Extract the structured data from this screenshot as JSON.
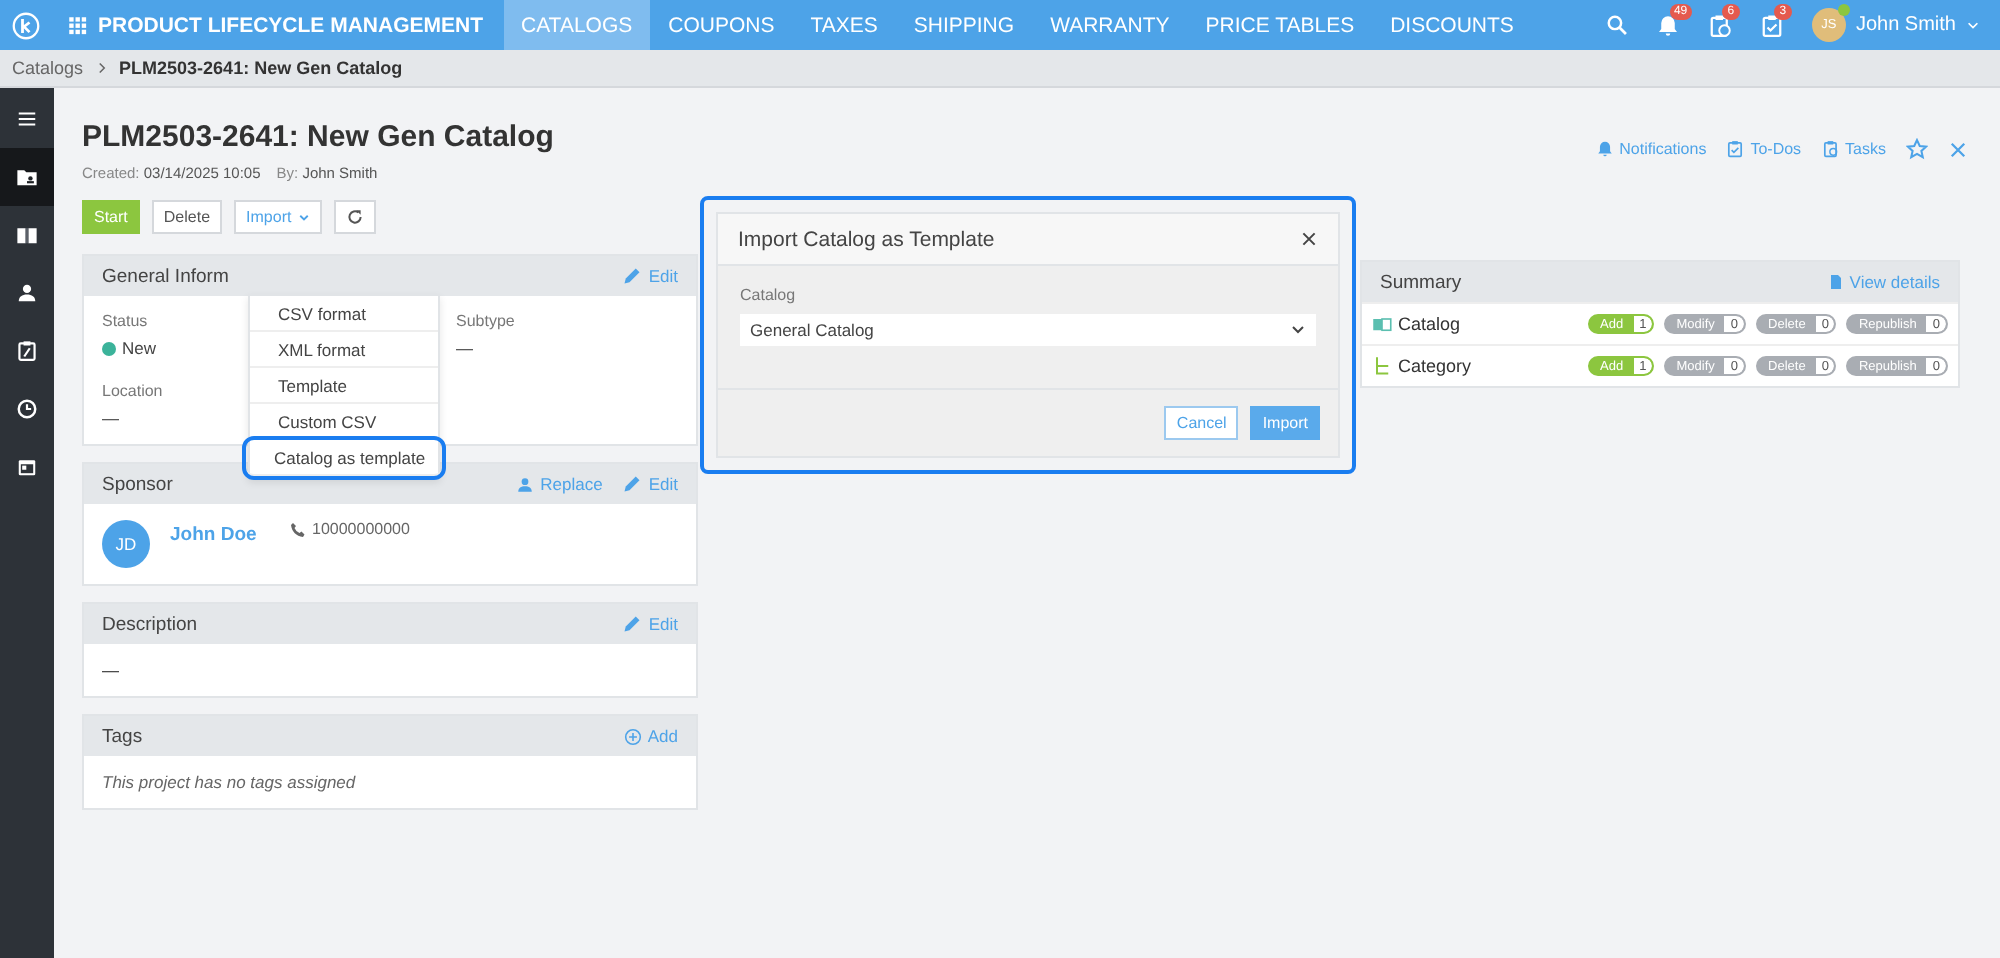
{
  "topbar": {
    "app_title": "PRODUCT LIFECYCLE MANAGEMENT",
    "tabs": [
      {
        "label": "CATALOGS",
        "selected": true
      },
      {
        "label": "COUPONS",
        "selected": false
      },
      {
        "label": "TAXES",
        "selected": false
      },
      {
        "label": "SHIPPING",
        "selected": false
      },
      {
        "label": "WARRANTY",
        "selected": false
      },
      {
        "label": "PRICE TABLES",
        "selected": false
      },
      {
        "label": "DISCOUNTS",
        "selected": false
      }
    ],
    "badges": [
      {
        "kind": "bell",
        "count": "49"
      },
      {
        "kind": "clipboard-clock",
        "count": "6"
      },
      {
        "kind": "clipboard-check",
        "count": "3"
      }
    ],
    "user": {
      "initials": "JS",
      "name": "John Smith"
    }
  },
  "breadcrumb": [
    "Catalogs",
    "PLM2503-2641: New Gen Catalog"
  ],
  "sidebar": [
    {
      "kind": "folder",
      "selected": true
    },
    {
      "kind": "book",
      "selected": false
    },
    {
      "kind": "person",
      "selected": false
    },
    {
      "kind": "clipboard",
      "selected": false
    },
    {
      "kind": "clock",
      "selected": false
    },
    {
      "kind": "calendar",
      "selected": false
    }
  ],
  "header": {
    "title": "PLM2503-2641: New Gen Catalog",
    "created_label": "Created:",
    "created": "03/14/2025 10:05",
    "by_label": "By:",
    "by": "John Smith",
    "links": [
      {
        "kind": "bell",
        "label": "Notifications"
      },
      {
        "kind": "check",
        "label": "To-Dos"
      },
      {
        "kind": "clock",
        "label": "Tasks"
      }
    ]
  },
  "actions": {
    "start": "Start",
    "delete": "Delete",
    "import": "Import"
  },
  "import_menu": [
    {
      "label": "CSV format",
      "highlighted": false
    },
    {
      "label": "XML format",
      "highlighted": false
    },
    {
      "label": "Template",
      "highlighted": false
    },
    {
      "label": "Custom CSV",
      "highlighted": false
    },
    {
      "label": "Catalog as template",
      "highlighted": true
    }
  ],
  "general": {
    "title": "General Inform",
    "edit": "Edit",
    "status_label": "Status",
    "status": "New",
    "subtype_label": "Subtype",
    "subtype": "—",
    "location_label": "Location",
    "location": "—"
  },
  "sponsor": {
    "title": "Sponsor",
    "replace": "Replace",
    "edit": "Edit",
    "initials": "JD",
    "name": "John Doe",
    "phone": "10000000000"
  },
  "description": {
    "title": "Description",
    "edit": "Edit",
    "text": "—"
  },
  "tags": {
    "title": "Tags",
    "add": "Add",
    "empty": "This project has no tags assigned"
  },
  "modal": {
    "title": "Import Catalog as Template",
    "highlighted": true,
    "field_label": "Catalog",
    "value": "General Catalog",
    "cancel": "Cancel",
    "confirm": "Import"
  },
  "summary": {
    "title": "Summary",
    "link": "View details",
    "rows": [
      {
        "kind": "catalog",
        "name": "Catalog",
        "tags": [
          {
            "label": "Add",
            "count": "1",
            "color": "#8cc63f"
          },
          {
            "label": "Modify",
            "count": "0",
            "color": "#a9adb3"
          },
          {
            "label": "Delete",
            "count": "0",
            "color": "#a9adb3"
          },
          {
            "label": "Republish",
            "count": "0",
            "color": "#a9adb3"
          }
        ]
      },
      {
        "kind": "category",
        "name": "Category",
        "tags": [
          {
            "label": "Add",
            "count": "1",
            "color": "#8cc63f"
          },
          {
            "label": "Modify",
            "count": "0",
            "color": "#a9adb3"
          },
          {
            "label": "Delete",
            "count": "0",
            "color": "#a9adb3"
          },
          {
            "label": "Republish",
            "count": "0",
            "color": "#a9adb3"
          }
        ]
      }
    ]
  }
}
